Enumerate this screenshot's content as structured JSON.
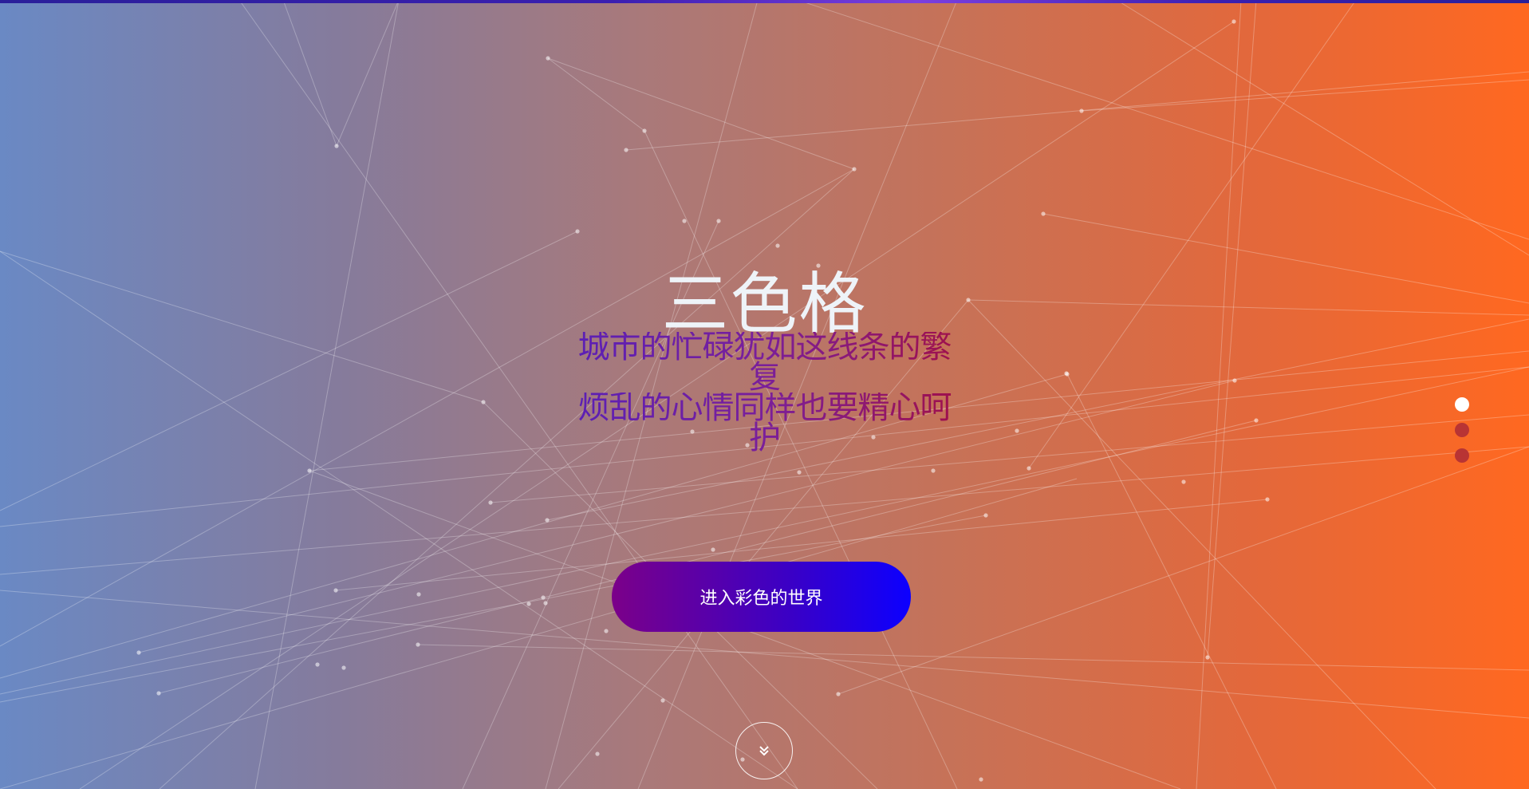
{
  "hero": {
    "title": "三色格",
    "subtitle_lines": [
      "城市的忙碌犹如这线条的繁复",
      "烦乱的心情同样也要精心呵护"
    ],
    "enter_button_label": "进入彩色的世界"
  },
  "scroll_down": {
    "icon": "chevron-double-down-icon"
  },
  "dots_nav": {
    "items": [
      "slide-1",
      "slide-2",
      "slide-3"
    ],
    "active_index": 0
  },
  "colors": {
    "gradient_left": "#6a89c4",
    "gradient_right": "#ff6820",
    "title_color": "#eef3f8",
    "button_left": "#7b0089",
    "button_right": "#0c00ff",
    "dot_inactive": "#b83434",
    "dot_active": "#ffffff"
  }
}
